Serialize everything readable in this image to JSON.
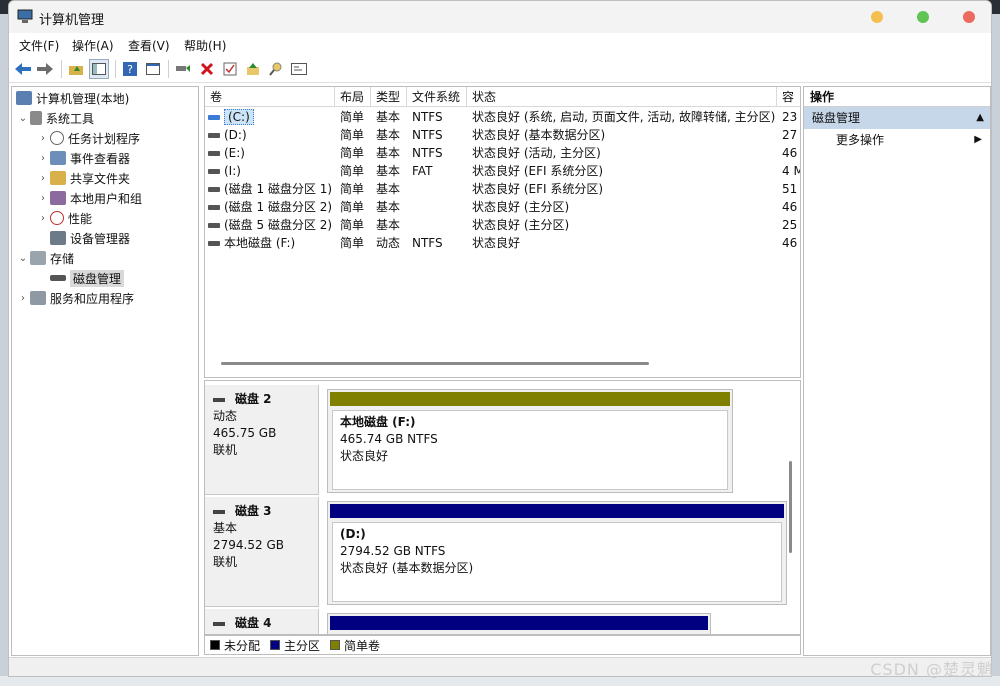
{
  "window": {
    "title": "计算机管理"
  },
  "menu": [
    "文件(F)",
    "操作(A)",
    "查看(V)",
    "帮助(H)"
  ],
  "tree": {
    "root": "计算机管理(本地)",
    "system_tools": "系统工具",
    "task_scheduler": "任务计划程序",
    "event_viewer": "事件查看器",
    "shared_folders": "共享文件夹",
    "local_users": "本地用户和组",
    "performance": "性能",
    "device_manager": "设备管理器",
    "storage": "存储",
    "disk_management": "磁盘管理",
    "services_apps": "服务和应用程序"
  },
  "list": {
    "headers": [
      "卷",
      "布局",
      "类型",
      "文件系统",
      "状态",
      "容"
    ],
    "rows": [
      {
        "volume": "(C:)",
        "layout": "简单",
        "type": "基本",
        "fs": "NTFS",
        "status": "状态良好 (系统, 启动, 页面文件, 活动, 故障转储, 主分区)",
        "cap": "23"
      },
      {
        "volume": "(D:)",
        "layout": "简单",
        "type": "基本",
        "fs": "NTFS",
        "status": "状态良好 (基本数据分区)",
        "cap": "27"
      },
      {
        "volume": "(E:)",
        "layout": "简单",
        "type": "基本",
        "fs": "NTFS",
        "status": "状态良好 (活动, 主分区)",
        "cap": "46"
      },
      {
        "volume": "(I:)",
        "layout": "简单",
        "type": "基本",
        "fs": "FAT",
        "status": "状态良好 (EFI 系统分区)",
        "cap": "4 M"
      },
      {
        "volume": "(磁盘 1 磁盘分区 1)",
        "layout": "简单",
        "type": "基本",
        "fs": "",
        "status": "状态良好 (EFI 系统分区)",
        "cap": "51"
      },
      {
        "volume": "(磁盘 1 磁盘分区 2)",
        "layout": "简单",
        "type": "基本",
        "fs": "",
        "status": "状态良好 (主分区)",
        "cap": "46"
      },
      {
        "volume": "(磁盘 5 磁盘分区 2)",
        "layout": "简单",
        "type": "基本",
        "fs": "",
        "status": "状态良好 (主分区)",
        "cap": "25"
      },
      {
        "volume": "本地磁盘 (F:)",
        "layout": "简单",
        "type": "动态",
        "fs": "NTFS",
        "status": "状态良好",
        "cap": "46"
      }
    ]
  },
  "disks": [
    {
      "name": "磁盘 2",
      "kind": "动态",
      "size": "465.75 GB",
      "state": "联机",
      "part": {
        "name": "本地磁盘  (F:)",
        "size": "465.74 GB NTFS",
        "status": "状态良好",
        "color": "#808000"
      }
    },
    {
      "name": "磁盘 3",
      "kind": "基本",
      "size": "2794.52 GB",
      "state": "联机",
      "part": {
        "name": "(D:)",
        "size": "2794.52 GB NTFS",
        "status": "状态良好 (基本数据分区)",
        "color": "#000080"
      }
    },
    {
      "name": "磁盘 4",
      "color": "#000080"
    }
  ],
  "legend": [
    {
      "label": "未分配",
      "color": "#000000"
    },
    {
      "label": "主分区",
      "color": "#000080"
    },
    {
      "label": "简单卷",
      "color": "#808000"
    }
  ],
  "actions": {
    "header": "操作",
    "group": "磁盘管理",
    "more": "更多操作"
  },
  "watermark": "CSDN @楚灵魈"
}
